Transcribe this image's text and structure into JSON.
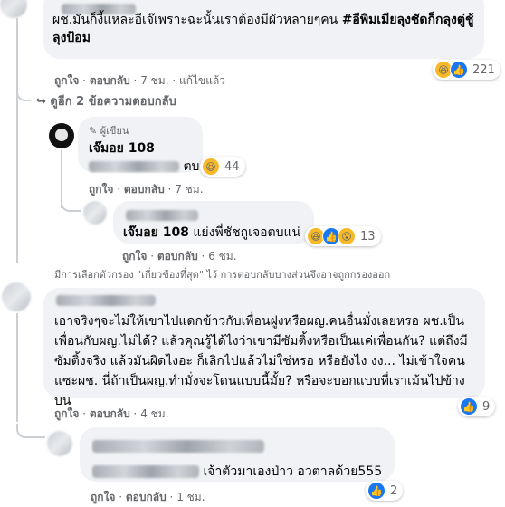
{
  "comment1": {
    "text_a": "ผช.มันก็งี้แหละอีเจ๊เพราะฉะนั้นเราต้องมีผัวหลายๆคน ",
    "hashtag": "#อีพิมเมียลุงชัดก็กลุงตู่ชู้ลุงป้อม",
    "like": "ถูกใจ",
    "reply": "ตอบกลับ",
    "time": "7 ชม.",
    "edited": "แก้ไขแล้ว",
    "reaction_count": "221",
    "see_replies": "ดูอีก 2 ข้อความตอบกลับ"
  },
  "reply_author": {
    "badge": "ผู้เขียน",
    "name": "เจ๊มอย 108",
    "text_tail": "ตบ",
    "reaction_count": "44",
    "like": "ถูกใจ",
    "reply": "ตอบกลับ",
    "time": "7 ชม."
  },
  "reply_user": {
    "mention": "เจ๊มอย 108",
    "text": " แย่งพี่ชัชกูเจอตบแน่",
    "reaction_count": "13",
    "like": "ถูกใจ",
    "reply": "ตอบกลับ",
    "time": "6 ชม."
  },
  "filter_notice": "มีการเลือกตัวกรอง \"เกี่ยวข้องที่สุด\" ไว้ การตอบกลับบางส่วนจึงอาจถูกกรองออก",
  "comment2": {
    "text": "เอาจริงๆจะไม่ให้เขาไปแดกข้าวกับเพื่อนฝูงหรือผญ.คนอื่นมั่งเลยหรอ ผช.เป็นเพื่อนกับผญ.ไม่ได้? แล้วคุณรู้ได้ไงว่าเขามีซัมติ้งหรือเป็นแค่เพื่อนกัน? แต่ถึงมีซัมติ้งจริง แล้วมันผิดไงอะ ก็เลิกไปแล้วไม่ใช่หรอ หรือยังไง งง... ไม่เข้าใจคนแซะผช. นี่ถ้าเป็นผญ.ทำมั่งจะโดนแบบนี้มั้ย? หรือจะบอกแบบที่เราเม้นไปข้างบน",
    "reaction_count": "9",
    "like": "ถูกใจ",
    "reply": "ตอบกลับ",
    "time": "4 ชม."
  },
  "comment3": {
    "text": "เจ้าตัวมาเองป่าว อวตาลด้วย555",
    "reaction_count": "2",
    "like": "ถูกใจ",
    "reply": "ตอบกลับ",
    "time": "1 ชม."
  },
  "colors": {
    "link": "#050505",
    "meta": "#65676b",
    "bubble": "#f0f2f5",
    "like_blue": "#1877f2",
    "haha_yellow": "#f7b928"
  },
  "icons": [
    "haha-emoji-icon",
    "like-icon",
    "wow-emoji-icon",
    "reply-arrow-icon",
    "author-badge-icon"
  ]
}
